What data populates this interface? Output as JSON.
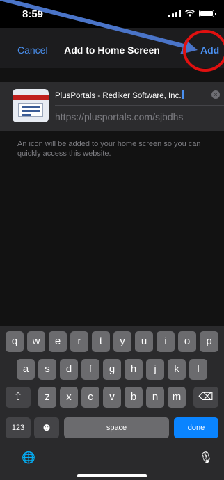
{
  "status_bar": {
    "time": "8:59"
  },
  "nav": {
    "cancel_label": "Cancel",
    "title": "Add to Home Screen",
    "add_label": "Add"
  },
  "bookmark": {
    "name_value": "PlusPortals - Rediker Software, Inc.",
    "url": "https://plusportals.com/sjbdhs",
    "clear_symbol": "×"
  },
  "description": "An icon will be added to your home screen so you can quickly access this website.",
  "keyboard": {
    "row1": [
      "q",
      "w",
      "e",
      "r",
      "t",
      "y",
      "u",
      "i",
      "o",
      "p"
    ],
    "row2": [
      "a",
      "s",
      "d",
      "f",
      "g",
      "h",
      "j",
      "k",
      "l"
    ],
    "row3": [
      "z",
      "x",
      "c",
      "v",
      "b",
      "n",
      "m"
    ],
    "shift_symbol": "⇧",
    "delete_symbol": "⌫",
    "numbers_label": "123",
    "emoji_symbol": "☻",
    "space_label": "space",
    "done_label": "done",
    "globe_symbol": "🌐",
    "mic_symbol": "🎙"
  },
  "colors": {
    "accent": "#4a90f0",
    "done": "#0a84ff",
    "annotation_arrow": "#4a74c8",
    "annotation_circle": "#e01010"
  }
}
